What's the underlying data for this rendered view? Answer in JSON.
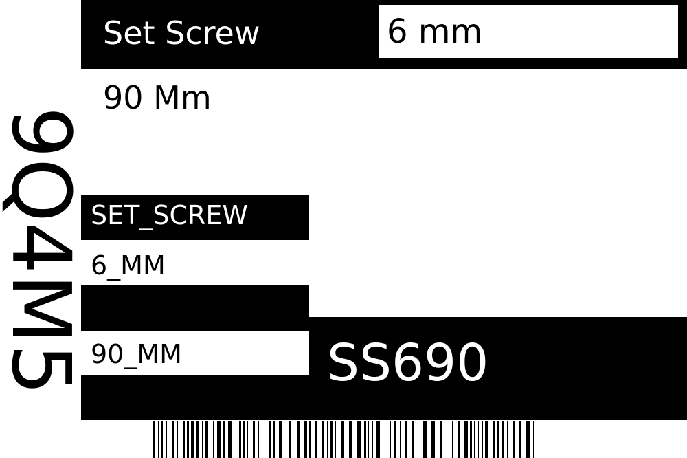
{
  "label": {
    "product_name": "Set Screw",
    "size": "6 mm",
    "length": "90 Mm",
    "vertical_code": "9Q4M5",
    "field_product": "SET_SCREW",
    "field_size": "6_MM",
    "field_length": "90_MM",
    "sku": "SS690"
  },
  "colors": {
    "foreground": "#000000",
    "background": "#ffffff"
  }
}
